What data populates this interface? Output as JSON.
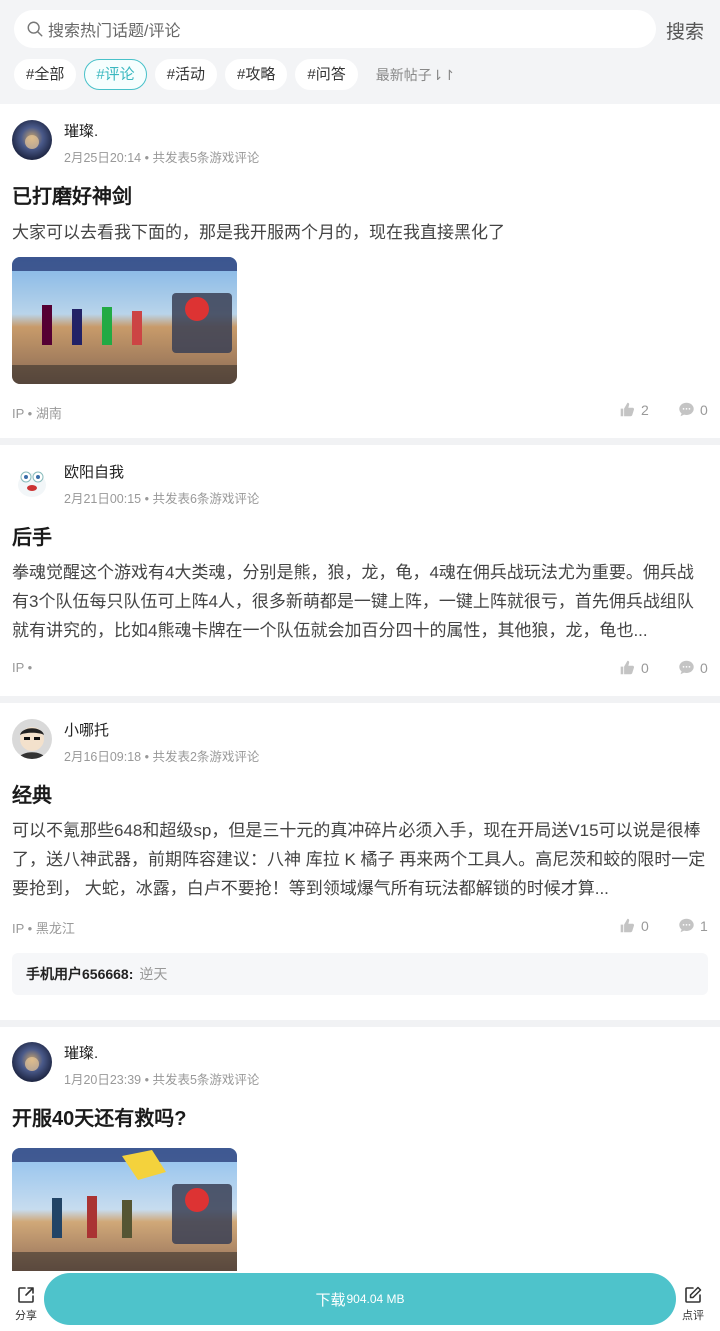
{
  "header": {
    "search_placeholder": "搜索热门话题/评论",
    "search_button": "搜索",
    "tabs": [
      {
        "label": "#全部",
        "active": false
      },
      {
        "label": "#评论",
        "active": true
      },
      {
        "label": "#活动",
        "active": false
      },
      {
        "label": "#攻略",
        "active": false
      },
      {
        "label": "#问答",
        "active": false
      }
    ],
    "sort_label": "最新帖子⇂↾"
  },
  "posts": [
    {
      "username": "璀璨.",
      "meta": "2月25日20:14 • 共发表5条游戏评论",
      "title": "已打磨好神剑",
      "body": "大家可以去看我下面的，那是我开服两个月的，现在我直接黑化了",
      "ip": "IP • 湖南",
      "likes": "2",
      "comments": "0"
    },
    {
      "username": "欧阳自我",
      "meta": "2月21日00:15 • 共发表6条游戏评论",
      "title": "后手",
      "body": "拳魂觉醒这个游戏有4大类魂，分别是熊，狼，龙，龟，4魂在佣兵战玩法尤为重要。佣兵战有3个队伍每只队伍可上阵4人，很多新萌都是一键上阵，一键上阵就很亏，首先佣兵战组队就有讲究的，比如4熊魂卡牌在一个队伍就会加百分四十的属性，其他狼，龙，龟也...",
      "ip": "IP •",
      "likes": "0",
      "comments": "0"
    },
    {
      "username": "小哪托",
      "meta": "2月16日09:18 • 共发表2条游戏评论",
      "title": "经典",
      "body": "可以不氪那些648和超级sp，但是三十元的真冲碎片必须入手，现在开局送V15可以说是很棒了，送八神武器，前期阵容建议：八神 库拉 K 橘子 再来两个工具人。高尼茨和蛟的限时一定要抢到， 大蛇，冰露，白卢不要抢！等到领域爆气所有玩法都解锁的时候才算...",
      "ip": "IP • 黑龙江",
      "likes": "0",
      "comments": "1",
      "reply": {
        "user": "手机用户656668:",
        "text": "逆天"
      }
    },
    {
      "username": "璀璨.",
      "meta": "1月20日23:39 • 共发表5条游戏评论",
      "title": "开服40天还有救吗?"
    }
  ],
  "bottom": {
    "share_label": "分享",
    "download_label": "下载",
    "download_size": "904.04 MB",
    "review_label": "点评"
  },
  "colors": {
    "accent": "#4ec3cb",
    "tab_active_border": "#48c1c9"
  }
}
